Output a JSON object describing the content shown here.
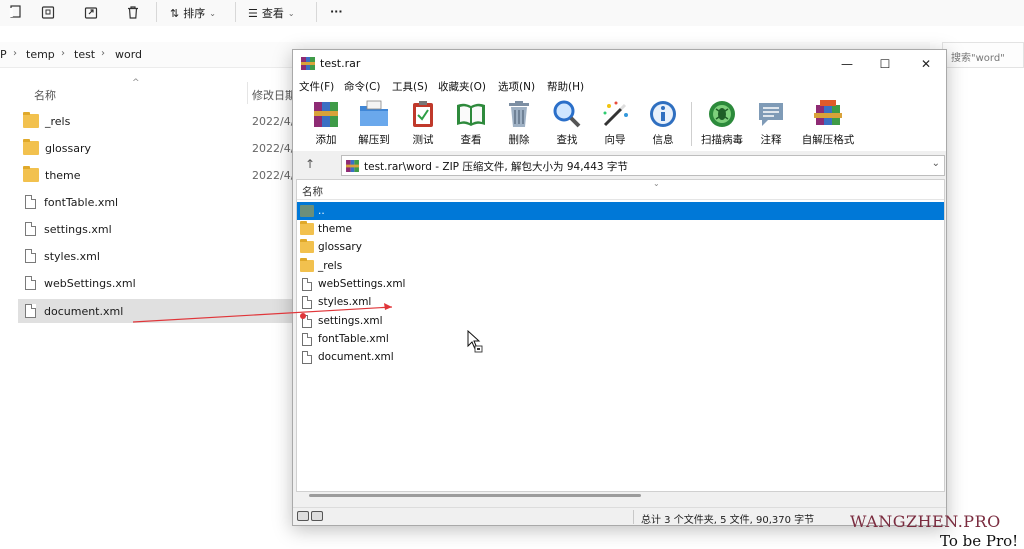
{
  "explorer": {
    "toolbar": {
      "sort_label": "排序",
      "view_label": "查看",
      "more_label": "···"
    },
    "breadcrumb": {
      "root": "P",
      "items": [
        "temp",
        "test",
        "word"
      ]
    },
    "search_placeholder": "搜索\"word\"",
    "columns": {
      "name": "名称",
      "date": "修改日期"
    },
    "rows": [
      {
        "name": "_rels",
        "type": "folder",
        "date": "2022/4/"
      },
      {
        "name": "glossary",
        "type": "folder",
        "date": "2022/4/"
      },
      {
        "name": "theme",
        "type": "folder",
        "date": "2022/4/"
      },
      {
        "name": "fontTable.xml",
        "type": "file"
      },
      {
        "name": "settings.xml",
        "type": "file"
      },
      {
        "name": "styles.xml",
        "type": "file"
      },
      {
        "name": "webSettings.xml",
        "type": "file"
      },
      {
        "name": "document.xml",
        "type": "file",
        "selected": true
      }
    ]
  },
  "winrar": {
    "title": "test.rar",
    "menu": [
      "文件(F)",
      "命令(C)",
      "工具(S)",
      "收藏夹(O)",
      "选项(N)",
      "帮助(H)"
    ],
    "tools": [
      "添加",
      "解压到",
      "测试",
      "查看",
      "删除",
      "查找",
      "向导",
      "信息",
      "扫描病毒",
      "注释",
      "自解压格式"
    ],
    "path": "test.rar\\word - ZIP 压缩文件, 解包大小为 94,443 字节",
    "list_header": "名称",
    "items": [
      {
        "name": "..",
        "type": "up",
        "selected": true
      },
      {
        "name": "theme",
        "type": "folder"
      },
      {
        "name": "glossary",
        "type": "folder"
      },
      {
        "name": "_rels",
        "type": "folder"
      },
      {
        "name": "webSettings.xml",
        "type": "file"
      },
      {
        "name": "styles.xml",
        "type": "file"
      },
      {
        "name": "settings.xml",
        "type": "file"
      },
      {
        "name": "fontTable.xml",
        "type": "file"
      },
      {
        "name": "document.xml",
        "type": "file"
      }
    ],
    "status": "总计 3 个文件夹, 5 文件, 90,370 字节"
  },
  "watermark": {
    "line1": "WANGZHEN.PRO",
    "line2": "To be Pro!"
  },
  "colors": {
    "selection_blue": "#0078d7",
    "arrow_red": "#e0363a",
    "watermark": "#7a2c3f"
  }
}
